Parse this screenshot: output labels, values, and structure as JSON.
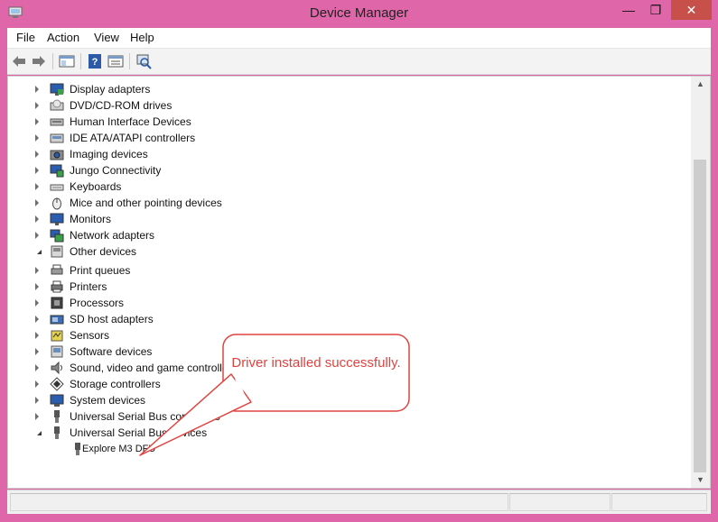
{
  "window": {
    "title": "Device Manager"
  },
  "titlebar": {
    "minimize": "—",
    "maximize": "❐",
    "close": "✕"
  },
  "menu": {
    "items": [
      "File",
      "Action",
      "View",
      "Help"
    ]
  },
  "tree": {
    "items": [
      {
        "label": "Display adapters",
        "icon": "display-adapter-icon",
        "expanded": false
      },
      {
        "label": "DVD/CD-ROM drives",
        "icon": "dvd-drive-icon",
        "expanded": false
      },
      {
        "label": "Human Interface Devices",
        "icon": "hid-icon",
        "expanded": false
      },
      {
        "label": "IDE ATA/ATAPI controllers",
        "icon": "ide-controller-icon",
        "expanded": false
      },
      {
        "label": "Imaging devices",
        "icon": "camera-icon",
        "expanded": false
      },
      {
        "label": "Jungo Connectivity",
        "icon": "jungo-icon",
        "expanded": false
      },
      {
        "label": "Keyboards",
        "icon": "keyboard-icon",
        "expanded": false
      },
      {
        "label": "Mice and other pointing devices",
        "icon": "mouse-icon",
        "expanded": false
      },
      {
        "label": "Monitors",
        "icon": "monitor-icon",
        "expanded": false
      },
      {
        "label": "Network adapters",
        "icon": "network-adapter-icon",
        "expanded": false
      },
      {
        "label": "Other devices",
        "icon": "other-devices-icon",
        "expanded": true
      },
      {
        "label": "Print queues",
        "icon": "print-queue-icon",
        "expanded": false
      },
      {
        "label": "Printers",
        "icon": "printer-icon",
        "expanded": false
      },
      {
        "label": "Processors",
        "icon": "processor-icon",
        "expanded": false
      },
      {
        "label": "SD host adapters",
        "icon": "sd-card-icon",
        "expanded": false
      },
      {
        "label": "Sensors",
        "icon": "sensor-icon",
        "expanded": false
      },
      {
        "label": "Software devices",
        "icon": "software-device-icon",
        "expanded": false
      },
      {
        "label": "Sound, video and game controllers",
        "icon": "speaker-icon",
        "expanded": false
      },
      {
        "label": "Storage controllers",
        "icon": "storage-controller-icon",
        "expanded": false
      },
      {
        "label": "System devices",
        "icon": "system-device-icon",
        "expanded": false
      },
      {
        "label": "Universal Serial Bus controllers",
        "icon": "usb-icon",
        "expanded": false
      },
      {
        "label": "Universal Serial Bus devices",
        "icon": "usb-icon",
        "expanded": true
      }
    ],
    "child": {
      "label": "Explore M3 DFU",
      "icon": "usb-device-icon"
    }
  },
  "callout": {
    "text": "Driver installed successfully."
  },
  "colors": {
    "frame": "#df67a9",
    "close": "#c7504b",
    "callout_border": "#e0433f",
    "callout_text": "#e0433f"
  }
}
